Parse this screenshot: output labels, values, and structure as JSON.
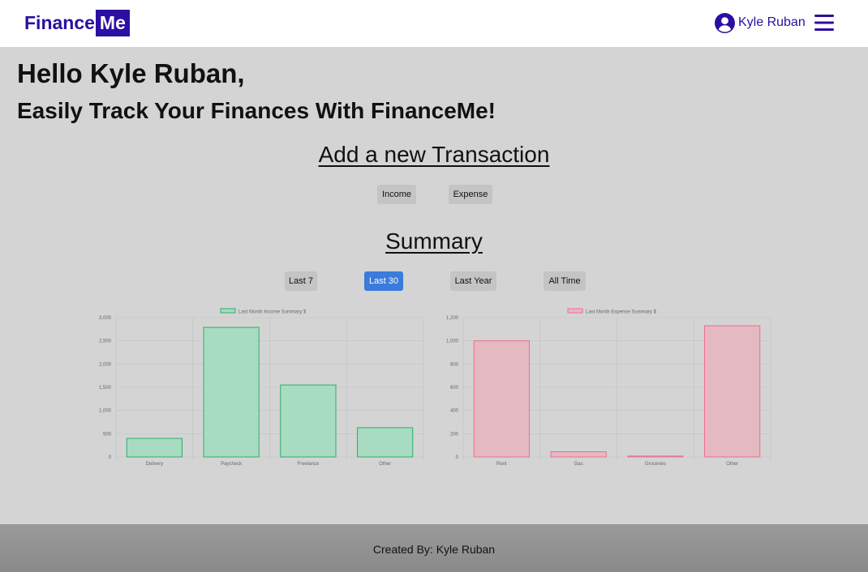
{
  "navbar": {
    "brand_part1": "Finance",
    "brand_part2": "Me",
    "user_name": "Kyle Ruban",
    "brand_color": "#2b0fa3"
  },
  "greeting": {
    "hello": "Hello Kyle Ruban,",
    "tagline": "Easily Track Your Finances With FinanceMe!"
  },
  "add_transaction": {
    "title": "Add a new Transaction",
    "income_label": "Income",
    "expense_label": "Expense"
  },
  "summary": {
    "title": "Summary",
    "filters": [
      "Last 7",
      "Last 30",
      "Last Year",
      "All Time"
    ],
    "active_filter": "Last 30",
    "active_color": "#3a7bdc"
  },
  "chart_data": [
    {
      "type": "bar",
      "legend": "Last Month Income Summary $",
      "categories": [
        "Delivery",
        "Paycheck",
        "Freelance",
        "Other"
      ],
      "values": [
        400,
        2790,
        1550,
        630
      ],
      "ylim": [
        0,
        3000
      ],
      "yticks": [
        "0",
        "500",
        "1,000",
        "1,500",
        "2,000",
        "2,500",
        "3,000"
      ],
      "ytick_values": [
        0,
        500,
        1000,
        1500,
        2000,
        2500,
        3000
      ],
      "fill": "#a8dcc0",
      "stroke": "#2fae6a",
      "grid": true,
      "legend_position": "top"
    },
    {
      "type": "bar",
      "legend": "Last Month Expense Summary $",
      "categories": [
        "Rent",
        "Gas",
        "Groceries",
        "Other"
      ],
      "values": [
        1000,
        45,
        8,
        1130
      ],
      "ylim": [
        0,
        1200
      ],
      "yticks": [
        "0",
        "200",
        "400",
        "600",
        "800",
        "1,000",
        "1,200"
      ],
      "ytick_values": [
        0,
        200,
        400,
        600,
        800,
        1000,
        1200
      ],
      "fill": "#e4b9c2",
      "stroke": "#f06d8d",
      "grid": true,
      "legend_position": "top"
    }
  ],
  "footer": {
    "text": "Created By: Kyle Ruban"
  }
}
